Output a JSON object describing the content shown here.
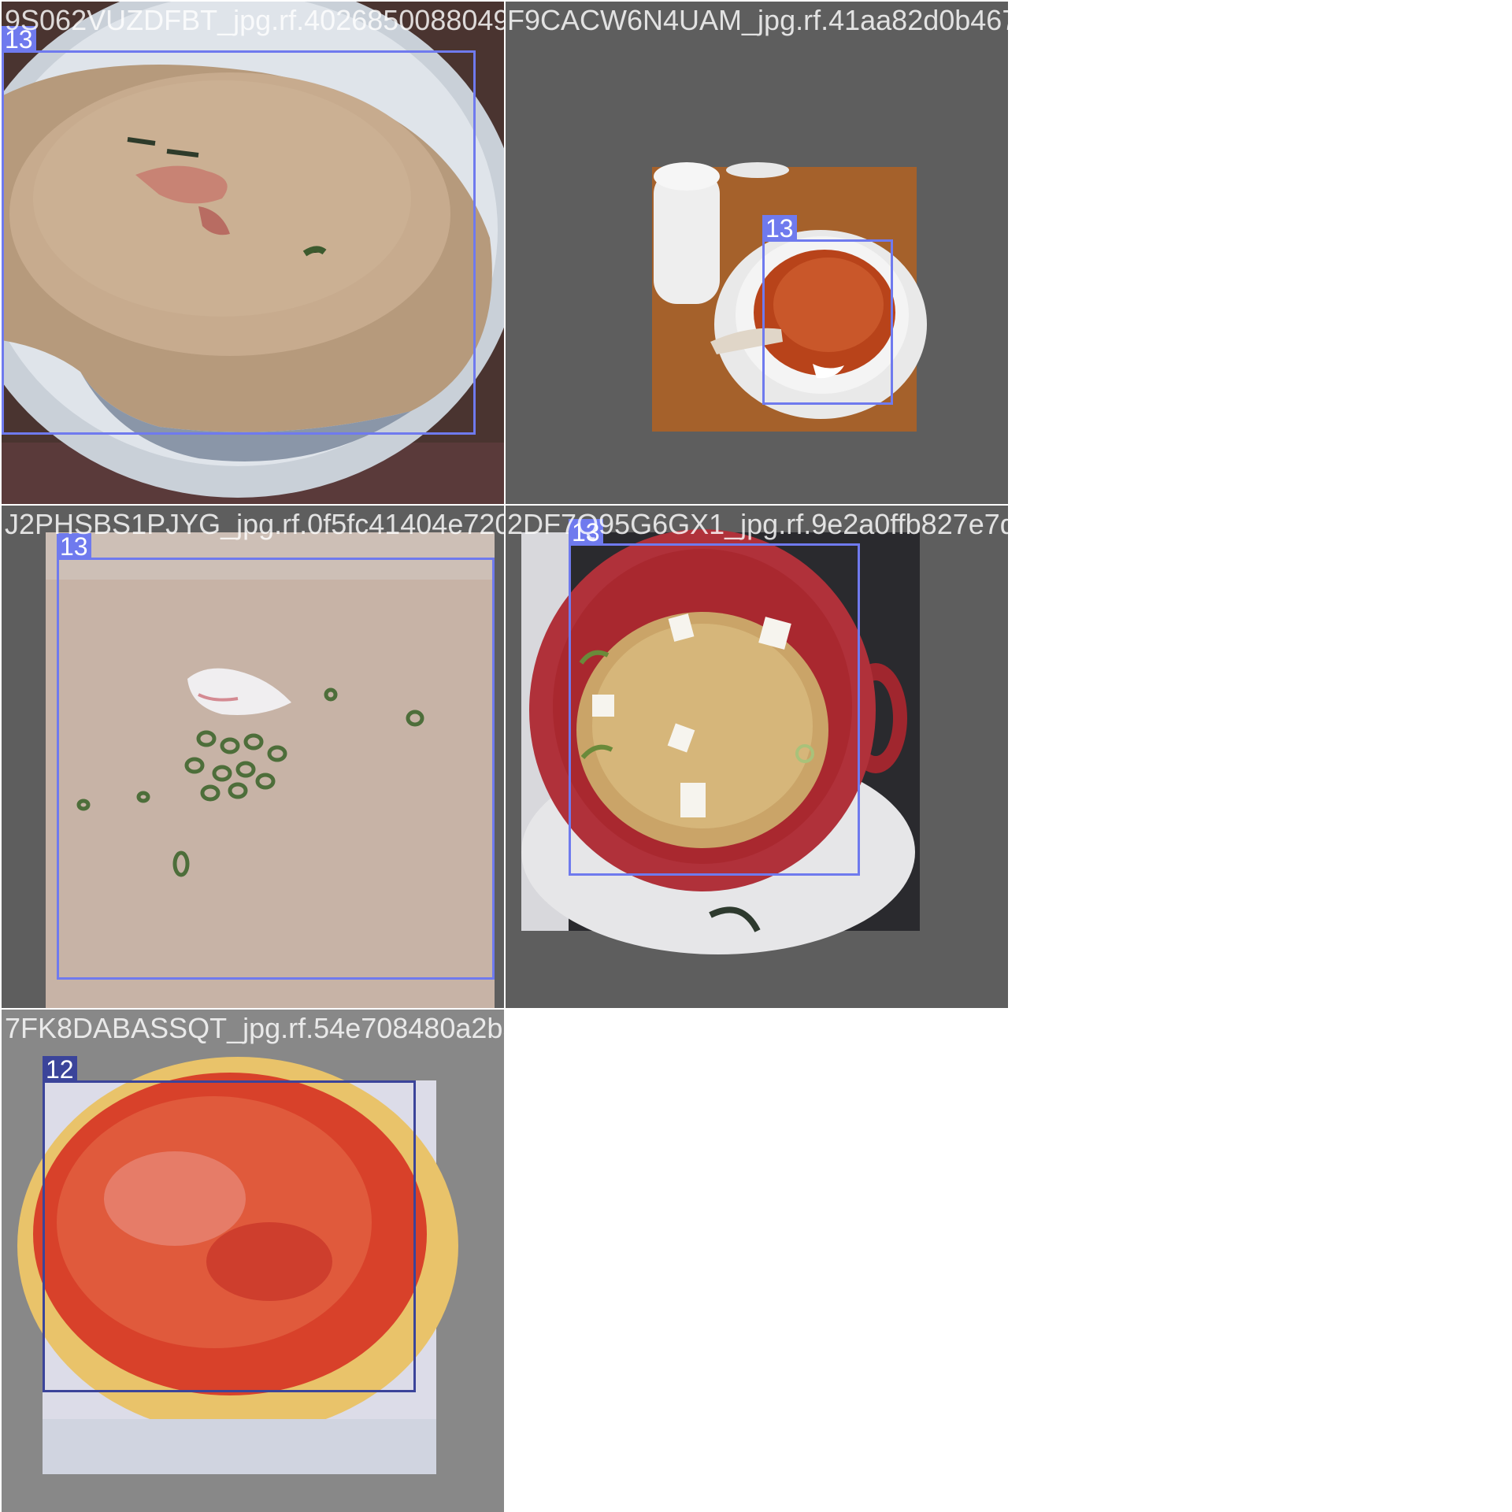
{
  "mosaic": {
    "tiles": [
      {
        "filename": "9S062VUZDFBT_jpg.rf.40268500880496640766",
        "label": "13"
      },
      {
        "filename": "F9CACW6N4UAM_jpg.rf.41aa82d0b467a0452c23",
        "label": "13"
      },
      {
        "filename": "J2PHSBS1PJYG_jpg.rf.0f5fc41404e72094c395",
        "label": "13"
      },
      {
        "filename": "2DF7Q95G6GX1_jpg.rf.9e2a0ffb827e7dd3cfda",
        "label": "13"
      },
      {
        "filename": "7FK8DABASSQT_jpg.rf.54e708480a2ba7934257",
        "label": "12"
      }
    ]
  },
  "colors": {
    "box_primary": "#6f7aee",
    "box_secondary": "#3b449a",
    "tile_background": "#5e5e5e",
    "canvas_background": "#ffffff"
  }
}
